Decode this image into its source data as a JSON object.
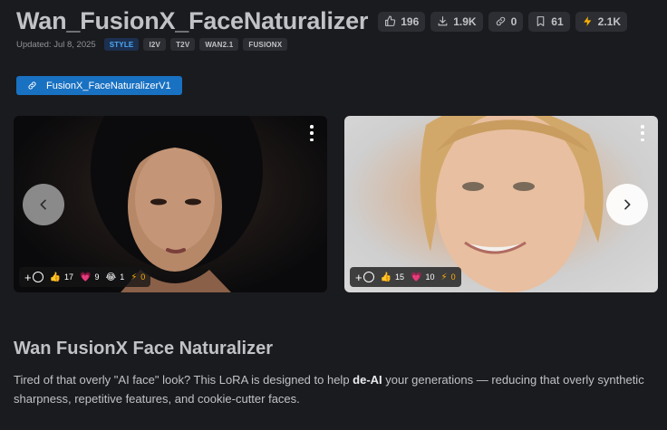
{
  "model": {
    "title": "Wan_FusionX_FaceNaturalizer",
    "stats": [
      {
        "icon": "thumbs-up-icon",
        "value": "196"
      },
      {
        "icon": "download-icon",
        "value": "1.9K"
      },
      {
        "icon": "link-icon",
        "value": "0"
      },
      {
        "icon": "bookmark-icon",
        "value": "61"
      },
      {
        "icon": "bolt-icon",
        "value": "2.1K"
      }
    ],
    "updated": "Updated: Jul 8, 2025",
    "tags": [
      "STYLE",
      "I2V",
      "T2V",
      "WAN2.1",
      "FUSIONX"
    ]
  },
  "version_button": "FusionX_FaceNaturalizerV1",
  "gallery": {
    "cards": [
      {
        "reactions": {
          "fire": "17",
          "heart": "9",
          "laugh": "1",
          "bolt": "0"
        }
      },
      {
        "reactions": {
          "fire": "15",
          "heart": "10",
          "bolt": "0"
        }
      }
    ]
  },
  "description": {
    "heading": "Wan FusionX Face Naturalizer",
    "text_before": "Tired of that overly \"AI face\" look? This LoRA is designed to help ",
    "text_bold": "de-AI",
    "text_after": " your generations — reducing that overly synthetic sharpness, repetitive features, and cookie-cutter faces."
  },
  "colors": {
    "background": "#1a1b1e",
    "accent": "#1971c2",
    "chip": "#2c2e33",
    "bolt": "#fab005"
  }
}
